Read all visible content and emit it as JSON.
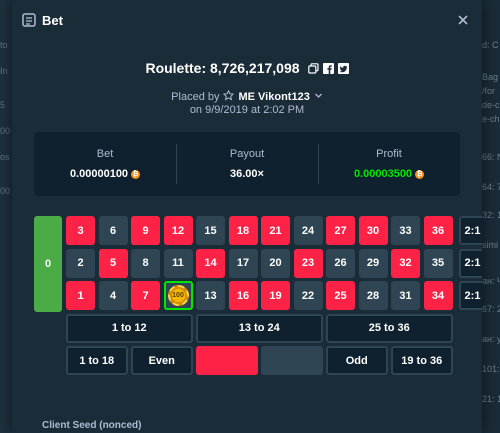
{
  "modal": {
    "title": "Bet",
    "game_title": "Roulette: 8,726,217,098",
    "placed_by_prefix": "Placed by",
    "username": "ME Vikont123",
    "date": "on 9/9/2019 at 2:02 PM",
    "stats": {
      "bet_label": "Bet",
      "bet_value": "0.00000100",
      "payout_label": "Payout",
      "payout_value": "36.00×",
      "profit_label": "Profit",
      "profit_value": "0.00003500"
    },
    "client_seed_label": "Client Seed (nonced)"
  },
  "board": {
    "zero": "0",
    "rows": [
      [
        {
          "n": "3",
          "c": "red"
        },
        {
          "n": "6",
          "c": "black"
        },
        {
          "n": "9",
          "c": "red"
        },
        {
          "n": "12",
          "c": "red"
        },
        {
          "n": "15",
          "c": "black"
        },
        {
          "n": "18",
          "c": "red"
        },
        {
          "n": "21",
          "c": "red"
        },
        {
          "n": "24",
          "c": "black"
        },
        {
          "n": "27",
          "c": "red"
        },
        {
          "n": "30",
          "c": "red"
        },
        {
          "n": "33",
          "c": "black"
        },
        {
          "n": "36",
          "c": "red"
        }
      ],
      [
        {
          "n": "2",
          "c": "black"
        },
        {
          "n": "5",
          "c": "red"
        },
        {
          "n": "8",
          "c": "black"
        },
        {
          "n": "11",
          "c": "black"
        },
        {
          "n": "14",
          "c": "red"
        },
        {
          "n": "17",
          "c": "black"
        },
        {
          "n": "20",
          "c": "black"
        },
        {
          "n": "23",
          "c": "red"
        },
        {
          "n": "26",
          "c": "black"
        },
        {
          "n": "29",
          "c": "black"
        },
        {
          "n": "32",
          "c": "red"
        },
        {
          "n": "35",
          "c": "black"
        }
      ],
      [
        {
          "n": "1",
          "c": "red"
        },
        {
          "n": "4",
          "c": "black"
        },
        {
          "n": "7",
          "c": "red"
        },
        {
          "n": "10",
          "c": "black"
        },
        {
          "n": "13",
          "c": "black"
        },
        {
          "n": "16",
          "c": "red"
        },
        {
          "n": "19",
          "c": "red"
        },
        {
          "n": "22",
          "c": "black"
        },
        {
          "n": "25",
          "c": "red"
        },
        {
          "n": "28",
          "c": "black"
        },
        {
          "n": "31",
          "c": "black"
        },
        {
          "n": "34",
          "c": "red"
        }
      ]
    ],
    "column_labels": [
      "2:1",
      "2:1",
      "2:1"
    ],
    "dozens": [
      "1 to 12",
      "13 to 24",
      "25 to 36"
    ],
    "outside": [
      "1 to 18",
      "Even",
      "",
      "",
      "Odd",
      "19 to 36"
    ],
    "selected_number": "10",
    "chip_value": "100"
  },
  "background_fragments": {
    "right": [
      "d: C",
      "Bag",
      "/for",
      "de-c",
      "e-ch",
      "66: N",
      "64: 7",
      "32: 1",
      "simi",
      "ан: Ч",
      "67: 2",
      "ан: y",
      "101: П",
      "21: 1"
    ],
    "left": [
      "to",
      "In",
      "5",
      "00",
      "os",
      "00"
    ]
  },
  "colors": {
    "red": "#fe2247",
    "black": "#2f4553",
    "green": "#4bab44",
    "profit": "#00e701",
    "btc": "#f7931a"
  }
}
